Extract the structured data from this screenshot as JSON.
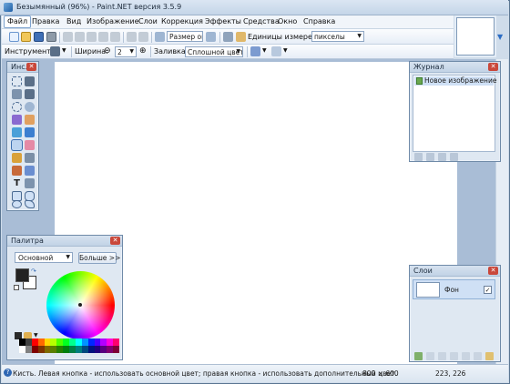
{
  "window": {
    "title": "Безымянный (96%) - Paint.NET версия 3.5.9"
  },
  "menu": [
    "Файл",
    "Правка",
    "Вид",
    "Изображение",
    "Слои",
    "Коррекция",
    "Эффекты",
    "Средства",
    "Окно",
    "Справка"
  ],
  "toolbar": {
    "zoom_label": "Размер ок",
    "units_label": "Единицы измерения:",
    "units_value": "пикселы"
  },
  "toolbar2": {
    "tool_label": "Инструмент:",
    "width_label": "Ширина:",
    "width_value": "2",
    "fill_label": "Заливка:",
    "fill_value": "Сплошной цвет"
  },
  "tools_panel": {
    "title": "Инс..."
  },
  "history_panel": {
    "title": "Журнал",
    "items": [
      "Новое изображение"
    ]
  },
  "layers_panel": {
    "title": "Слои",
    "layers": [
      {
        "name": "Фон",
        "visible": true
      }
    ]
  },
  "palette_panel": {
    "title": "Палитра",
    "mode": "Основной",
    "more_button": "Больше >>",
    "primary_color": "#222222",
    "secondary_color": "#ffffff"
  },
  "status": {
    "help_text": "Кисть. Левая кнопка - использовать основной цвет; правая кнопка - использовать дополнительный цвет.",
    "image_size": "800 × 600",
    "cursor_pos": "223, 226"
  },
  "colors": {
    "accent": "#3c6fb0",
    "canvas": "#ffffff",
    "workspace": "#a9bdd6"
  }
}
